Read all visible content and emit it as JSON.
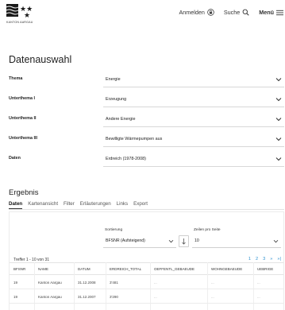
{
  "header": {
    "logo_text": "KANTON AARGAU",
    "nav": {
      "login_label": "Anmelden",
      "search_label": "Suche",
      "menu_label": "Menü"
    }
  },
  "page_title": "Datenauswahl",
  "form": [
    {
      "label": "Thema",
      "value": "Energie"
    },
    {
      "label": "Unterthema I",
      "value": "Erzeugung"
    },
    {
      "label": "Unterthema II",
      "value": "Andere Energie"
    },
    {
      "label": "Unterthema III",
      "value": "Bewilligte Wärmepumpen aus"
    },
    {
      "label": "Daten",
      "value": "Erdreich (1978-2008)"
    }
  ],
  "result": {
    "title": "Ergebnis",
    "tabs": [
      {
        "label": "Daten",
        "active": true
      },
      {
        "label": "Kartenansicht",
        "active": false
      },
      {
        "label": "Filter",
        "active": false
      },
      {
        "label": "Erläuterungen",
        "active": false
      },
      {
        "label": "Links",
        "active": false
      },
      {
        "label": "Export",
        "active": false
      }
    ],
    "sort_label": "Sortierung",
    "sort_value": "BFSNR (Aufsteigend)",
    "rows_label": "Zeilen pro Seite",
    "rows_value": "10",
    "hits_text": "Treffer 1 - 10 von 31",
    "pager": [
      "1",
      "2",
      "3",
      "»",
      "»|"
    ],
    "table": {
      "columns": [
        "BFSNR",
        "NAME",
        "DATUM",
        "ERDREICH_TOTAL",
        "OEFFENTL_GEBAEUDE",
        "WOHNGEBAEUDE",
        "UEBRIGE"
      ],
      "rows": [
        [
          "19",
          "Kanton Aargau",
          "31.12.2008",
          "3'481",
          "...",
          "...",
          "..."
        ],
        [
          "19",
          "Kanton Aargau",
          "31.12.2007",
          "3'290",
          "...",
          "...",
          "..."
        ]
      ]
    }
  }
}
